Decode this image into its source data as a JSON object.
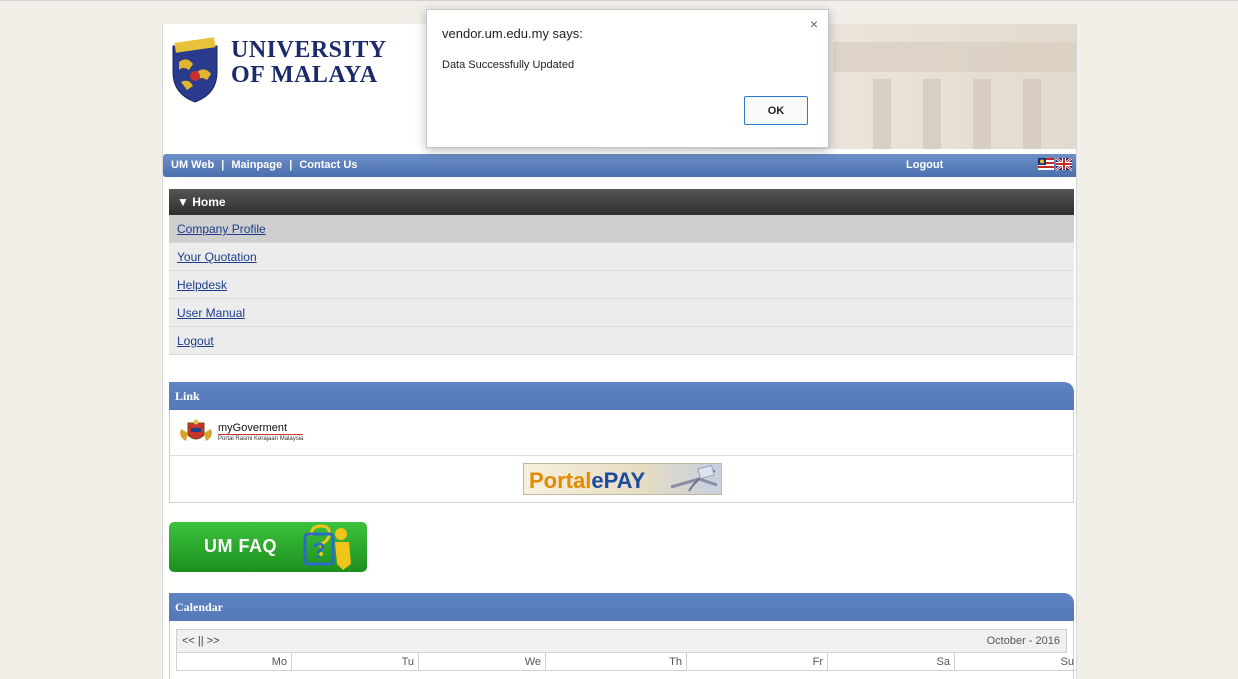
{
  "header": {
    "logo_line1": "UNIVERSITY",
    "logo_line2": "OF MALAYA"
  },
  "navbar": {
    "links": [
      "UM Web",
      "Mainpage",
      "Contact Us"
    ],
    "logout": "Logout",
    "flags_icon": "malaysia-uk-flags-icon"
  },
  "menu": {
    "header": "▼ Home",
    "items": [
      "Company Profile",
      "Your Quotation",
      "Helpdesk",
      "User Manual",
      "Logout"
    ]
  },
  "link_section": {
    "title": "Link",
    "mygov_title": "myGoverment",
    "mygov_sub": "Portal Rasmi Kerajaan Malaysia",
    "portal_part1": "Portal",
    "portal_part2": "ePAY"
  },
  "faq": {
    "label": "UM FAQ"
  },
  "calendar": {
    "title": "Calendar",
    "nav": "<< || >>",
    "month": "October - 2016",
    "days": [
      "Mo",
      "Tu",
      "We",
      "Th",
      "Fr",
      "Sa",
      "Su"
    ]
  },
  "dialog": {
    "title": "vendor.um.edu.my says:",
    "message": "Data Successfully Updated",
    "ok": "OK",
    "close": "×"
  },
  "colors": {
    "nav_blue": "#4a6fae",
    "section_blue": "#5478b8",
    "faq_green": "#1e8f1e",
    "dialog_accent": "#2b7bd6"
  }
}
